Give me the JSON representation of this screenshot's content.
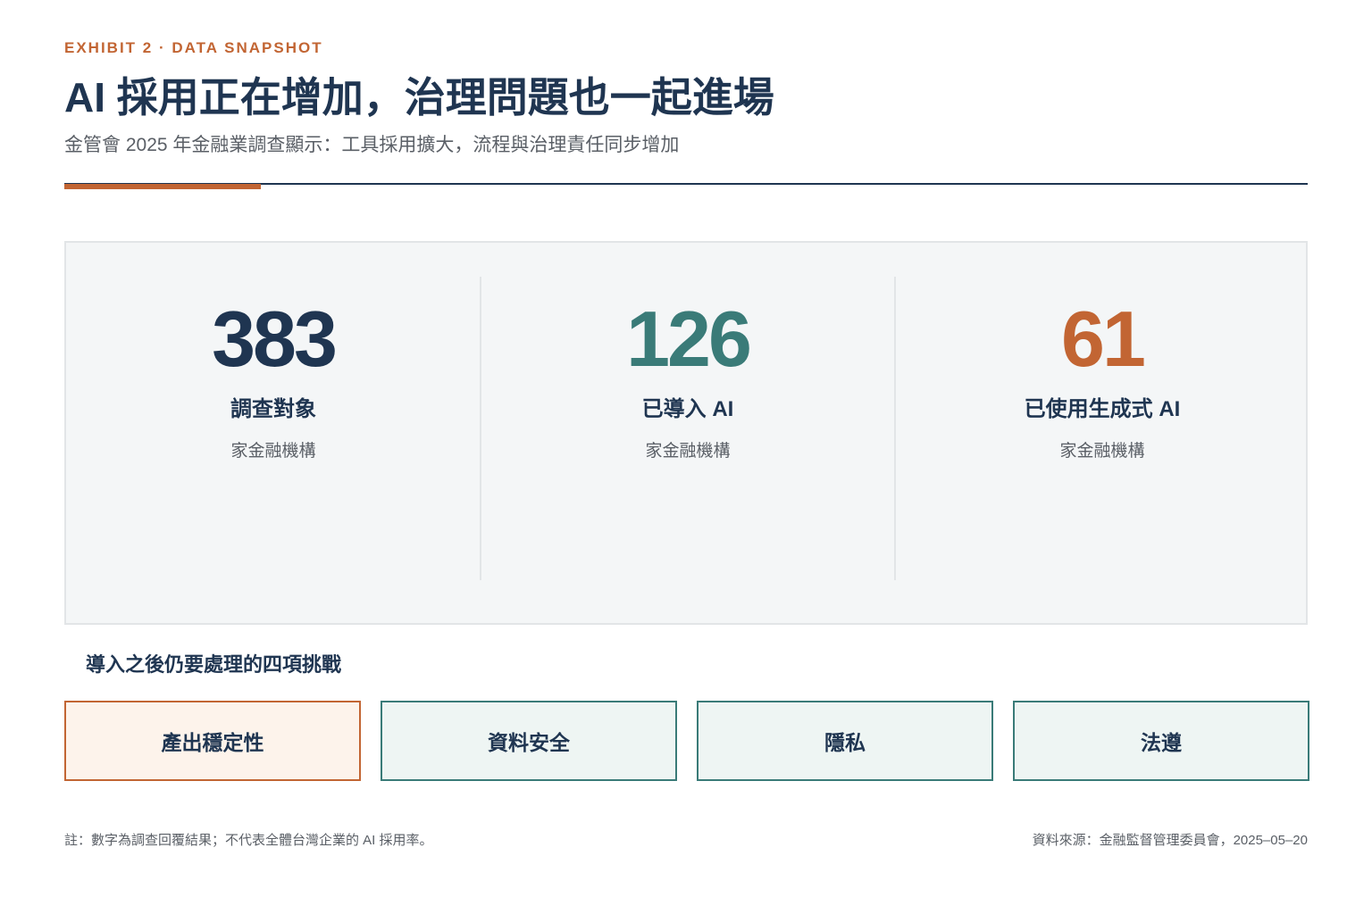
{
  "header": {
    "eyebrow": "EXHIBIT 2 · DATA SNAPSHOT",
    "title": "AI 採用正在增加，治理問題也一起進場",
    "subtitle": "金管會 2025 年金融業調查顯示：工具採用擴大，流程與治理責任同步增加"
  },
  "colors": {
    "navy": "#1f3551",
    "teal": "#3a7b78",
    "orange": "#c26533",
    "panel": "#f4f6f7"
  },
  "stats": [
    {
      "number": "383",
      "label": "調查對象",
      "unit": "家金融機構",
      "color": "#1f3551"
    },
    {
      "number": "126",
      "label": "已導入 AI",
      "unit": "家金融機構",
      "color": "#3a7b78"
    },
    {
      "number": "61",
      "label": "已使用生成式 AI",
      "unit": "家金融機構",
      "color": "#c26533"
    }
  ],
  "challenges": {
    "heading": "導入之後仍要處理的四項挑戰",
    "items": [
      "產出穩定性",
      "資料安全",
      "隱私",
      "法遵"
    ]
  },
  "footer": {
    "note": "註：數字為調查回覆結果；不代表全體台灣企業的 AI 採用率。",
    "source": "資料來源：金融監督管理委員會，2025–05–20"
  }
}
